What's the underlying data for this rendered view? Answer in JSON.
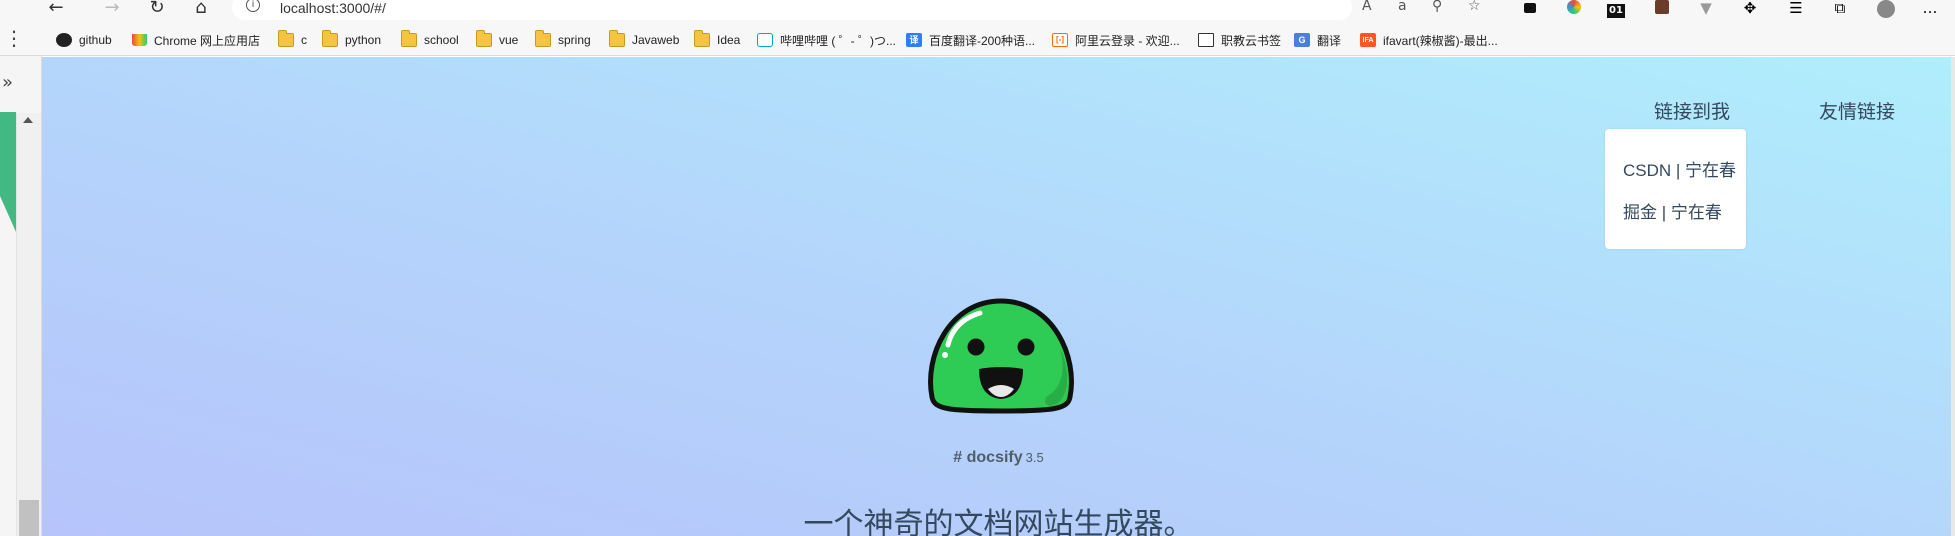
{
  "browser": {
    "url": "localhost:3000/#/",
    "back_icon": "arrow-left-icon",
    "forward_icon": "arrow-right-icon",
    "reload_icon": "reload-icon",
    "home_icon": "home-icon"
  },
  "bookmarks": [
    {
      "label": "github",
      "icon": "github-icon"
    },
    {
      "label": "Chrome 网上应用店",
      "icon": "chrome-store-icon"
    },
    {
      "label": "c",
      "icon": "folder-icon"
    },
    {
      "label": "python",
      "icon": "folder-icon"
    },
    {
      "label": "school",
      "icon": "folder-icon"
    },
    {
      "label": "vue",
      "icon": "folder-icon"
    },
    {
      "label": "spring",
      "icon": "folder-icon"
    },
    {
      "label": "Javaweb",
      "icon": "folder-icon"
    },
    {
      "label": "Idea",
      "icon": "folder-icon"
    },
    {
      "label": "哔哩哔哩 ( ゜- ゜)つ...",
      "icon": "bilibili-icon"
    },
    {
      "label": "百度翻译-200种语...",
      "icon": "baidu-translate-icon"
    },
    {
      "label": "阿里云登录 - 欢迎...",
      "icon": "aliyun-icon"
    },
    {
      "label": "职教云书签",
      "icon": "page-icon"
    },
    {
      "label": "翻译",
      "icon": "translate-icon"
    },
    {
      "label": "ifavart(辣椒酱)-最出...",
      "icon": "ifa-icon"
    }
  ],
  "ext_badge": "01",
  "nav": {
    "link_me": "链接到我",
    "friends": "友情链接",
    "dropdown": [
      "CSDN | 宁在春",
      "掘金 | 宁在春"
    ]
  },
  "cover": {
    "title": "# docsify",
    "version": "3.5",
    "tagline": "一个神奇的文档网站生成器。"
  },
  "colors": {
    "accent": "#42b983",
    "gradient_start": "#b0eefc",
    "gradient_end": "#b6c4fb",
    "text": "#34495e",
    "logo_green": "#2ecc54"
  }
}
